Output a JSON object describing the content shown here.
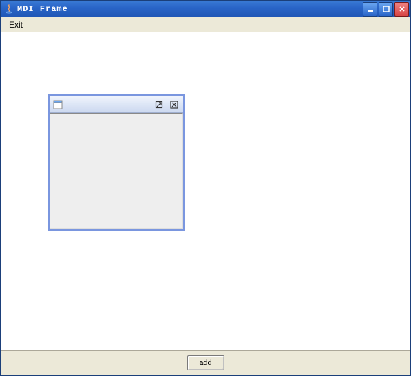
{
  "window": {
    "title": "MDI Frame"
  },
  "menubar": {
    "items": [
      {
        "label": "Exit"
      }
    ]
  },
  "internal_frame": {
    "title": ""
  },
  "bottom": {
    "add_label": "add"
  }
}
